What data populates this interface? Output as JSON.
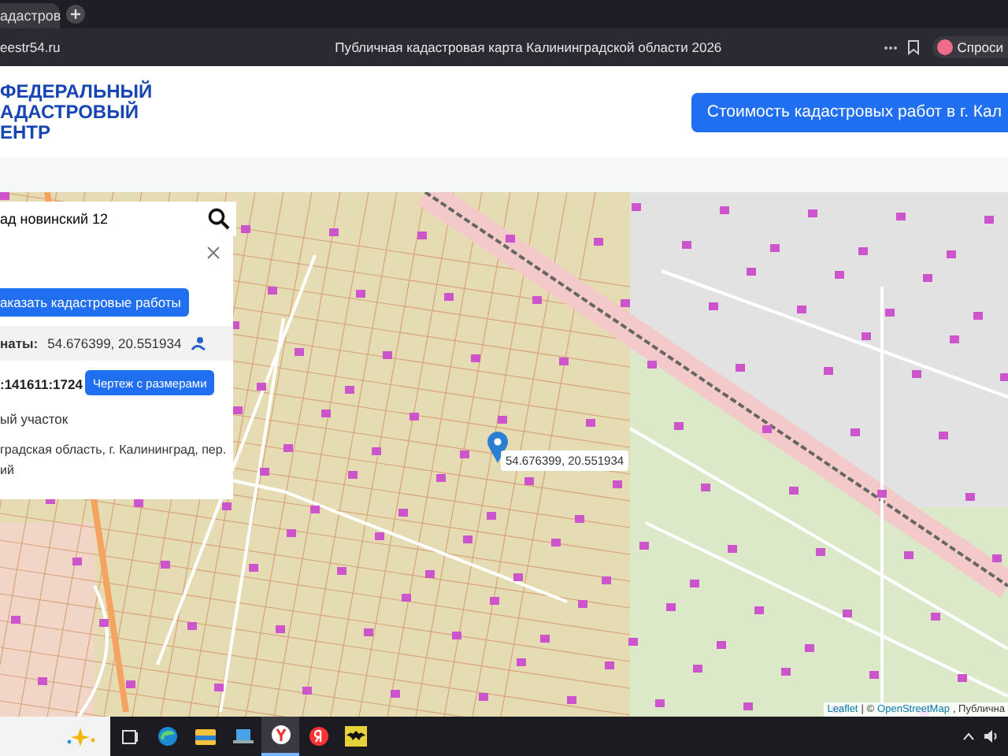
{
  "browser": {
    "tab": {
      "title": "адастров"
    },
    "address": "eestr54.ru",
    "page_title": "Публичная кадастровая карта Калининградской области 2026",
    "ask_button": "Спроси"
  },
  "header": {
    "logo_lines": [
      "ФЕДЕРАЛЬНЫЙ",
      "АДАСТРОВЫЙ",
      "ЕНТР"
    ],
    "cta_button": "Стоимость кадастровых работ в г. Кал"
  },
  "search": {
    "value": "ад новинский 12"
  },
  "info_panel": {
    "order_button": "аказать кадастровые работы",
    "coordinates_label": "наты:",
    "coordinates": "54.676399, 20.551934",
    "cadastral_number": ":141611:1724",
    "drawing_button": "Чертеж с размерами",
    "land_type": "ый участок",
    "address_lines": [
      "градская область, г. Калининград, пер.",
      "ий"
    ]
  },
  "map": {
    "marker_popup": "54.676399, 20.551934",
    "attribution": {
      "leaflet": "Leaflet",
      "separator": "| ©",
      "osm": "OpenStreetMap",
      "rest": ", Публична"
    }
  },
  "taskbar": {
    "apps": [
      {
        "kind": "taskview",
        "selected": false
      },
      {
        "kind": "edge",
        "selected": false
      },
      {
        "kind": "files",
        "selected": false
      },
      {
        "kind": "laptop",
        "selected": false
      },
      {
        "kind": "ybrowser",
        "selected": true
      },
      {
        "kind": "yandex",
        "selected": false
      },
      {
        "kind": "bat",
        "selected": false
      }
    ]
  }
}
